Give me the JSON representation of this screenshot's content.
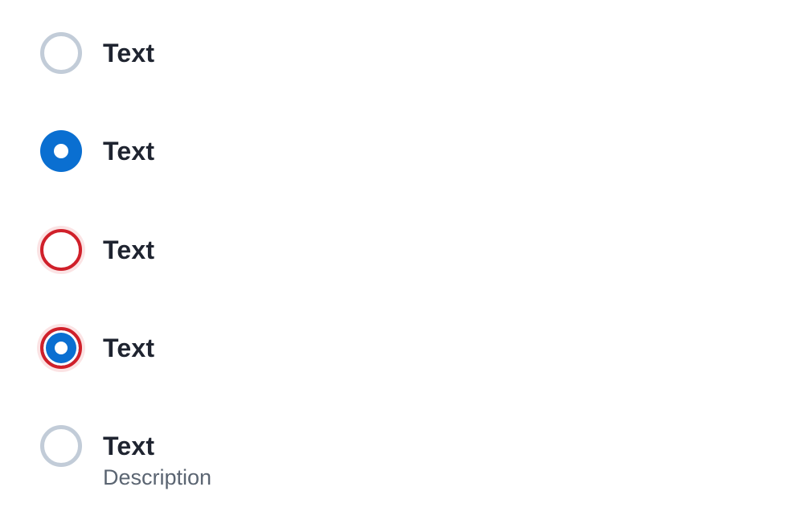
{
  "radios": [
    {
      "label": "Text",
      "state": "unchecked",
      "checked": false,
      "error": false
    },
    {
      "label": "Text",
      "state": "checked",
      "checked": true,
      "error": false
    },
    {
      "label": "Text",
      "state": "error-unchecked",
      "checked": false,
      "error": true
    },
    {
      "label": "Text",
      "state": "error-checked",
      "checked": true,
      "error": true
    },
    {
      "label": "Text",
      "description": "Description",
      "state": "unchecked",
      "checked": false,
      "error": false
    }
  ],
  "colors": {
    "checked_fill": "#0a6fd1",
    "unchecked_border": "#c2ccd8",
    "error_border": "#d0202a",
    "error_halo": "#fbe3e4",
    "label_text": "#1f2430",
    "description_text": "#5b6572"
  }
}
